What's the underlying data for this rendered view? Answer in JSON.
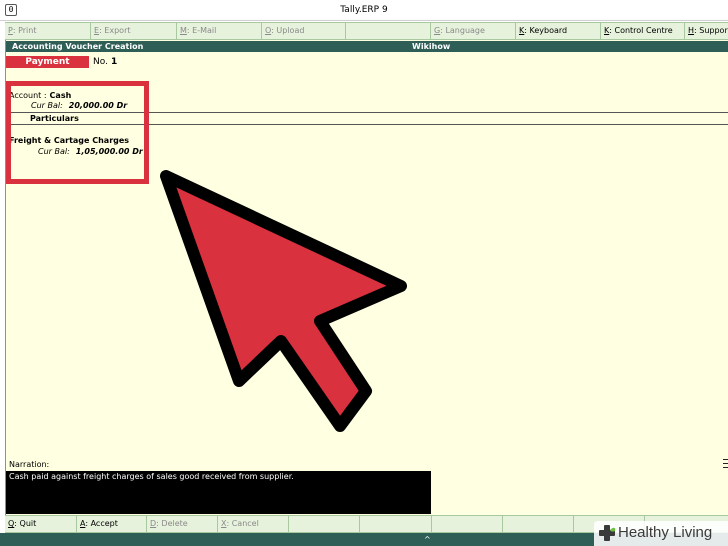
{
  "window": {
    "app_icon_glyph": "0",
    "title": "Tally.ERP 9"
  },
  "toolbar": {
    "items": [
      {
        "key": "P",
        "label": ": Print",
        "enabled": false
      },
      {
        "key": "E",
        "label": ": Export",
        "enabled": false
      },
      {
        "key": "M",
        "label": ": E-Mail",
        "enabled": false
      },
      {
        "key": "O",
        "label": ": Upload",
        "enabled": false
      },
      {
        "key": "",
        "label": "",
        "enabled": false
      },
      {
        "key": "G",
        "label": ": Language",
        "enabled": false
      },
      {
        "key": "K",
        "label": ": Keyboard",
        "enabled": true
      },
      {
        "key": "K",
        "label": ": Control Centre",
        "enabled": true
      },
      {
        "key": "H",
        "label": ": Support Centre",
        "enabled": true
      }
    ]
  },
  "header": {
    "left": "Accounting Voucher  Creation",
    "center": "Wikihow"
  },
  "voucher": {
    "type": "Payment",
    "number_label": "No.",
    "number": "1"
  },
  "account": {
    "label": "Account :",
    "name": "Cash",
    "balance_label": "Cur Bal:",
    "balance": "20,000.00 Dr"
  },
  "table": {
    "column_header": "Particulars"
  },
  "ledger": {
    "name": "Freight & Cartage Charges",
    "balance_label": "Cur Bal:",
    "balance": "1,05,000.00 Dr"
  },
  "narration": {
    "label": "Narration:",
    "text": "Cash paid against freight charges of sales good received from supplier."
  },
  "bottombar": {
    "items": [
      {
        "key": "Q",
        "label": ": Quit",
        "enabled": true
      },
      {
        "key": "A",
        "label": ": Accept",
        "enabled": true
      },
      {
        "key": "D",
        "label": ": Delete",
        "enabled": false
      },
      {
        "key": "X",
        "label": ": Cancel",
        "enabled": false
      }
    ]
  },
  "statusbar": {
    "caret_glyph": "^"
  },
  "watermark": {
    "text": "Healthy Living",
    "icon": "plus-leaf-icon"
  },
  "colors": {
    "accent_red": "#d9323e",
    "header_green": "#2e5e56",
    "toolbar_green": "#e6f2dc",
    "canvas_cream": "#ffffe1"
  }
}
